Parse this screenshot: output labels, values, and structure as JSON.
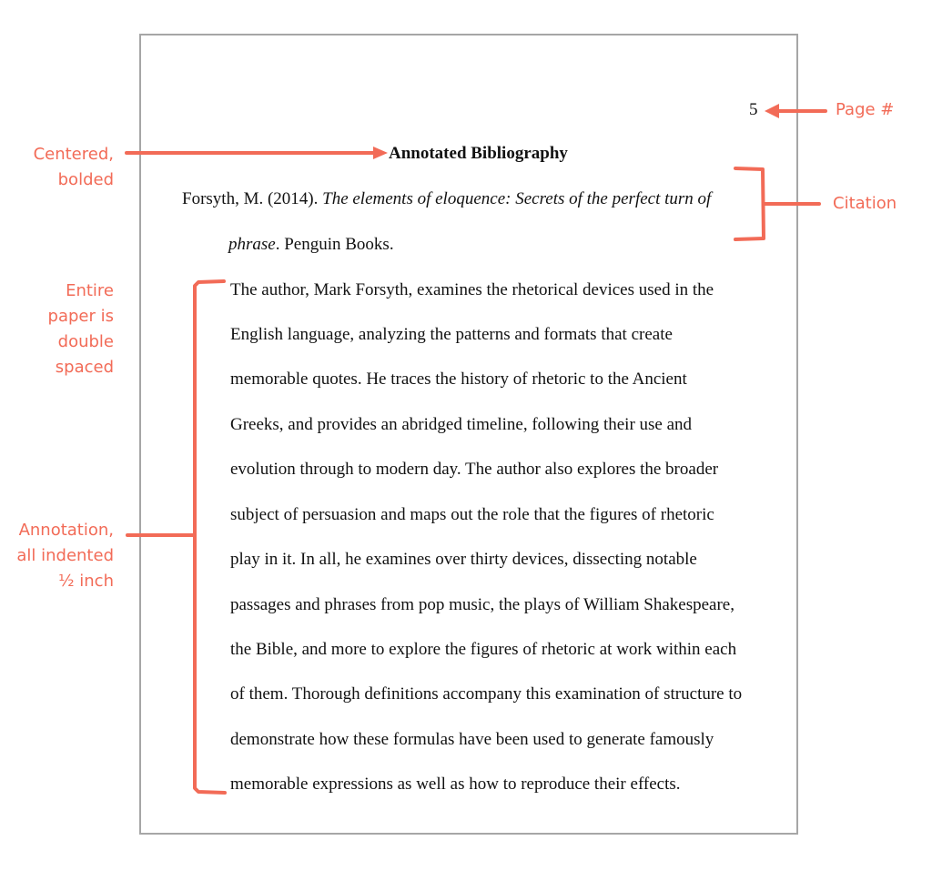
{
  "document": {
    "page_number": "5",
    "title": "Annotated Bibliography",
    "citation": {
      "line1_author": "Forsyth, M. (2014). ",
      "line1_title_italic": "The elements of eloquence: Secrets of the perfect turn of",
      "line2_title_italic": "phrase",
      "line2_rest": ". Penguin Books."
    },
    "annotation_lines": [
      "The author, Mark Forsyth, examines the rhetorical devices used in the",
      "English language, analyzing the patterns and formats that create",
      "memorable quotes. He traces the history of rhetoric to the Ancient",
      "Greeks, and provides an abridged timeline, following their use and",
      "evolution through to modern day. The author also explores the broader",
      "subject of persuasion and maps out the role that the figures of rhetoric",
      "play in it. In all, he examines over thirty devices, dissecting notable",
      "passages and phrases from pop music, the plays of William Shakespeare,",
      "the Bible, and more to explore the figures of rhetoric at work within each",
      "of them. Thorough definitions accompany this examination of structure to",
      "demonstrate how these formulas have been used to generate famously",
      "memorable expressions as well as how to reproduce their effects."
    ]
  },
  "callouts": {
    "centered_bolded": [
      "Centered,",
      "bolded"
    ],
    "page_num": "Page #",
    "citation": "Citation",
    "double_spaced": [
      "Entire",
      "paper is",
      "double",
      "spaced"
    ],
    "annotation_indent": [
      "Annotation,",
      "all indented",
      "½ inch"
    ]
  },
  "colors": {
    "accent": "#F26B57",
    "page_border": "#A6A6A6",
    "text": "#111111"
  }
}
